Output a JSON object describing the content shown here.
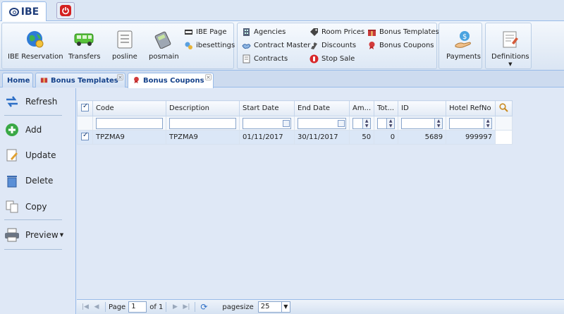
{
  "app": {
    "name": "IBE"
  },
  "ribbon": {
    "main_buttons": [
      {
        "label": "IBE Reservation"
      },
      {
        "label": "Transfers"
      },
      {
        "label": "posline"
      },
      {
        "label": "posmain"
      }
    ],
    "small_buttons_1": [
      {
        "label": "IBE Page"
      },
      {
        "label": "ibesettings"
      }
    ],
    "small_buttons_2": [
      {
        "label": "Agencies"
      },
      {
        "label": "Contract Master"
      },
      {
        "label": "Contracts"
      }
    ],
    "small_buttons_3": [
      {
        "label": "Room Prices"
      },
      {
        "label": "Discounts"
      },
      {
        "label": "Stop Sale"
      }
    ],
    "small_buttons_4": [
      {
        "label": "Bonus Templates"
      },
      {
        "label": "Bonus Coupons"
      }
    ],
    "payments_label": "Payments",
    "definitions_label": "Definitions"
  },
  "tabs": [
    {
      "label": "Home"
    },
    {
      "label": "Bonus Templates"
    },
    {
      "label": "Bonus Coupons"
    }
  ],
  "side_actions": [
    {
      "label": "Refresh"
    },
    {
      "label": "Add"
    },
    {
      "label": "Update"
    },
    {
      "label": "Delete"
    },
    {
      "label": "Copy"
    },
    {
      "label": "Preview"
    }
  ],
  "grid": {
    "columns": [
      "Code",
      "Description",
      "Start Date",
      "End Date",
      "Am...",
      "Tot...",
      "ID",
      "Hotel RefNo"
    ],
    "rows": [
      {
        "checked": true,
        "code": "TPZMA9",
        "description": "TPZMA9",
        "start_date": "01/11/2017",
        "end_date": "30/11/2017",
        "amount": "50",
        "total": "0",
        "id": "5689",
        "hotel_refno": "999997"
      }
    ]
  },
  "pager": {
    "page_label": "Page",
    "page_value": "1",
    "of_label": "of 1",
    "pagesize_label": "pagesize",
    "pagesize_value": "25"
  },
  "colors": {
    "accent": "#15428b",
    "header_bg": "#dfe8f6",
    "border": "#99bbe8",
    "power_red": "#d42020"
  }
}
